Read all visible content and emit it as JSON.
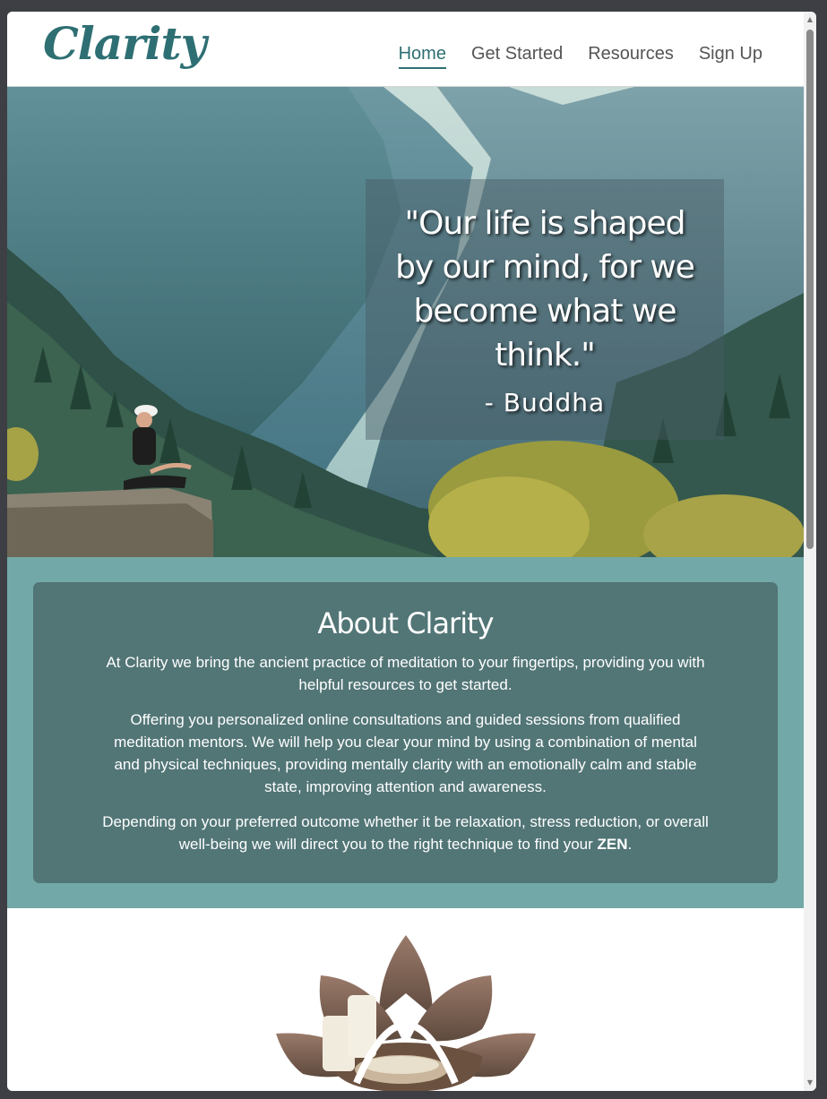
{
  "brand": {
    "logo": "Clarity",
    "accent": "#2e6f73"
  },
  "nav": {
    "items": [
      {
        "label": "Home",
        "active": true
      },
      {
        "label": "Get Started",
        "active": false
      },
      {
        "label": "Resources",
        "active": false
      },
      {
        "label": "Sign Up",
        "active": false
      }
    ]
  },
  "hero": {
    "quote": "\"Our life is shaped by our mind, for we become what we think.\"",
    "author": "- Buddha"
  },
  "about": {
    "title": "About Clarity",
    "paragraphs": [
      "At Clarity we bring the ancient practice of meditation to your fingertips, providing you with helpful resources to get started.",
      "Offering you personalized online consultations and guided sessions from qualified meditation mentors. We will help you clear your mind by using a combination of mental and physical techniques, providing mentally clarity with an emotionally calm and stable state, improving attention and awareness.",
      "Depending on your preferred outcome whether it be relaxation, stress reduction, or overall well-being we will direct you to the right technique to find your"
    ],
    "emphasis": "ZEN",
    "emphasis_suffix": "."
  },
  "colors": {
    "section_bg": "#72a8a8",
    "card_bg": "#527576",
    "nav_text": "#555555"
  }
}
